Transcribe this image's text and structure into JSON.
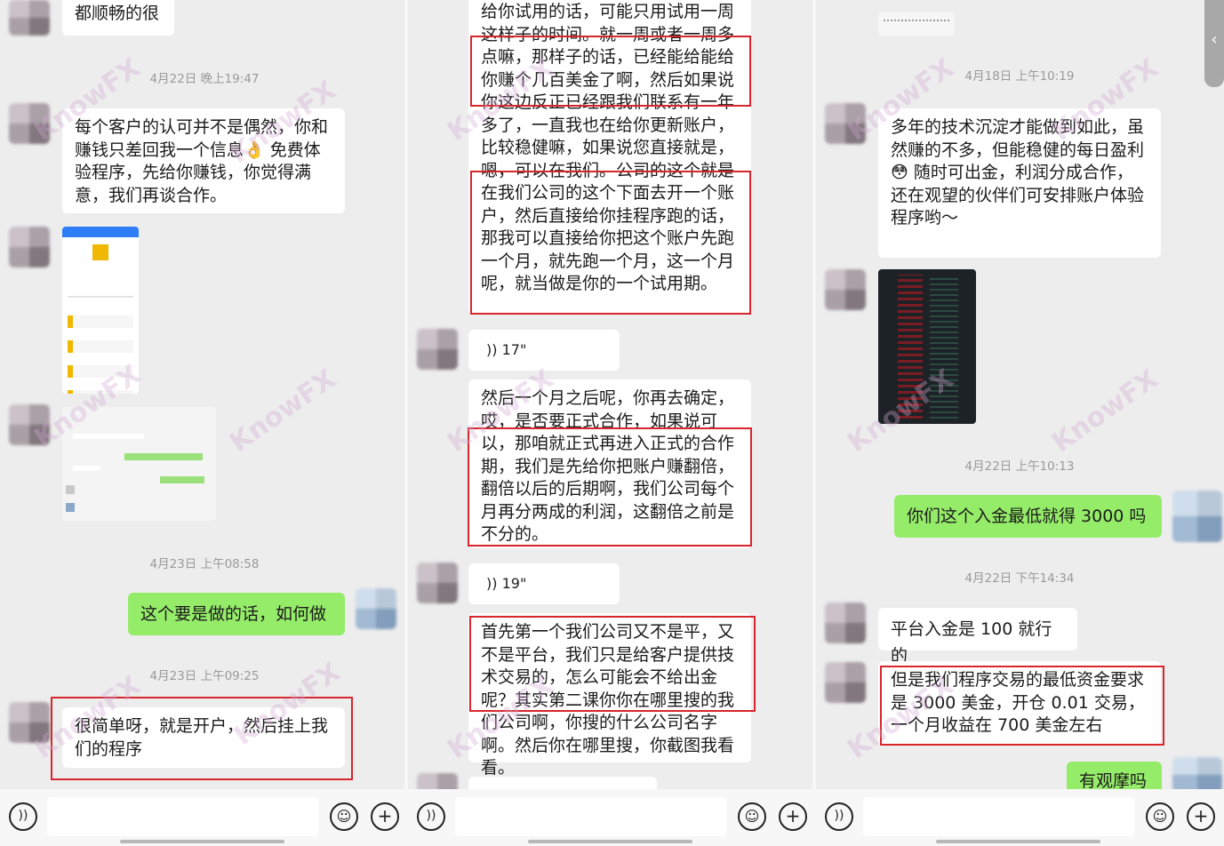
{
  "panel1": {
    "msg_top": "都顺畅的很",
    "ts1": "4月22日 晚上19:47",
    "msg1": "每个客户的认可并不是偶然，你和赚钱只差回我一个信息👌 免费体验程序，先给你赚钱，你觉得满意，我们再谈合作。",
    "ts2": "4月23日 上午08:58",
    "msg_self": "这个要是做的话，如何做",
    "ts3": "4月23日 上午09:25",
    "msg2": "很简单呀，就是开户，然后挂上我们的程序"
  },
  "panel2": {
    "msg1": "给你试用的话，可能只用试用一周这样子的时间。就一周或者一周多点嘛，那样子的话，已经能给能给你赚个几百美金了啊，然后如果说你这边反正已经跟我们联系有一年多了，一直我也在给你更新账户，比较稳健嘛，如果说您直接就是，嗯，可以在我们。公司的这个就是在我们公司的这个下面去开一个账户，然后直接给你挂程序跑的话，那我可以直接给你把这个账户先跑一个月，就先跑一个月，这一个月呢，就当做是你的一个试用期。",
    "voice1": "17\"",
    "msg2": "然后一个月之后呢，你再去确定，哎，是否要正式合作，如果说可以，那咱就正式再进入正式的合作期，我们是先给你把账户赚翻倍，翻倍以后的后期啊，我们公司每个月再分两成的利润，这翻倍之前是不分的。",
    "voice2": "19\"",
    "msg3": "首先第一个我们公司又不是平，又不是平台，我们只是给客户提供技术交易的，怎么可能会不给出金呢？其实第二课你你在哪里搜的我们公司啊，你搜的什么公司名字啊。然后你在哪里搜，你截图我看看。"
  },
  "panel3": {
    "ts1": "4月18日 上午10:19",
    "msg1": "多年的技术沉淀才能做到如此，虽然赚的不多，但能稳健的每日盈利😳 随时可出金，利润分成合作，还在观望的伙伴们可安排账户体验程序哟～",
    "ts2": "4月22日 上午10:13",
    "msg_self1": "你们这个入金最低就得 3000 吗",
    "ts3": "4月22日 下午14:34",
    "msg2": "平台入金是 100 就行的",
    "msg3": "但是我们程序交易的最低资金要求是 3000 美金，开仓 0.01 交易，一个月收益在 700 美金左右",
    "msg_self2": "有观摩吗"
  },
  "watermark": "KnowFX",
  "colors": {
    "red_box": "#d8262c",
    "self_bubble": "#95ec69",
    "background": "#ededed"
  },
  "icons": [
    "voice-icon",
    "emoji-icon",
    "plus-icon",
    "back-chevron-icon"
  ]
}
